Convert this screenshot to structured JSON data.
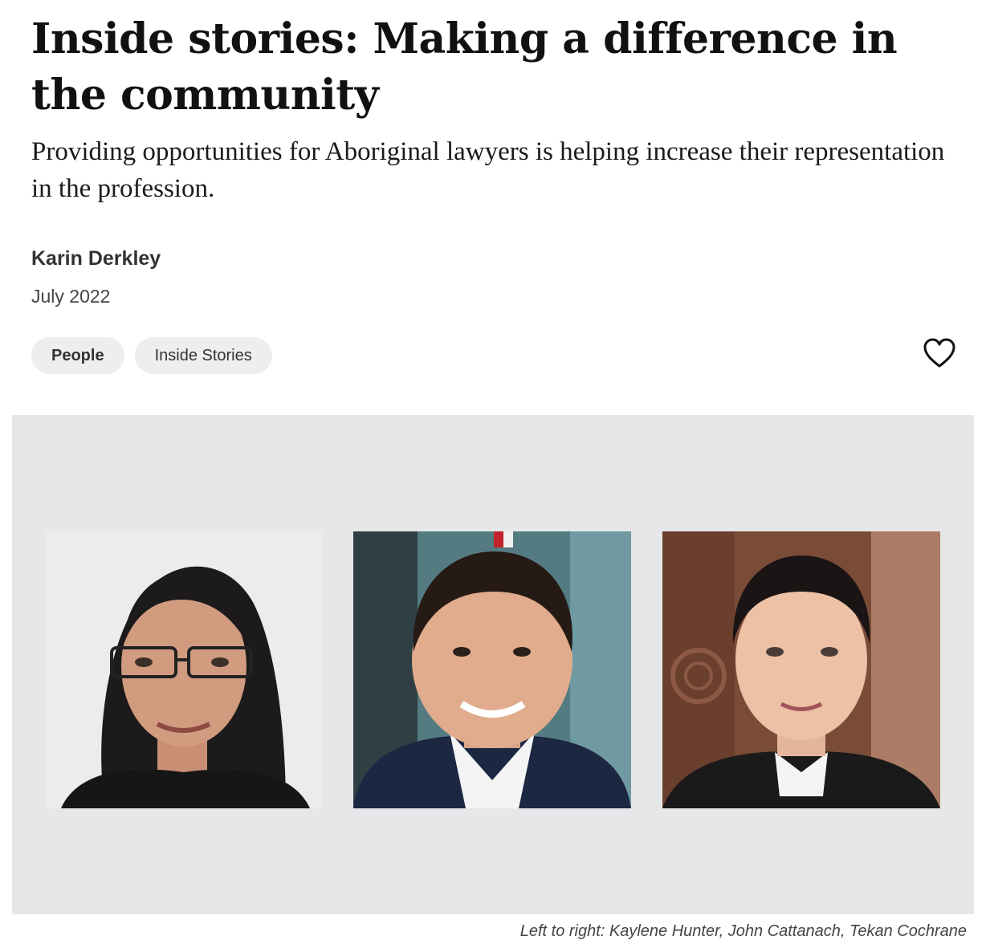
{
  "article": {
    "title": "Inside stories: Making a difference in the community",
    "subtitle": "Providing opportunities for Aboriginal lawyers is helping increase their representation in the profession.",
    "author": "Karin Derkley",
    "date": "July 2022"
  },
  "tags": [
    {
      "label": "People"
    },
    {
      "label": "Inside Stories"
    }
  ],
  "actions": {
    "favourite_icon": "heart-outline-icon"
  },
  "image": {
    "caption": "Left to right: Kaylene Hunter, John Cattanach, Tekan Cochrane",
    "background": "#e6e7e9"
  },
  "colors": {
    "text": "#111111",
    "tag_background": "#eeeeee"
  }
}
